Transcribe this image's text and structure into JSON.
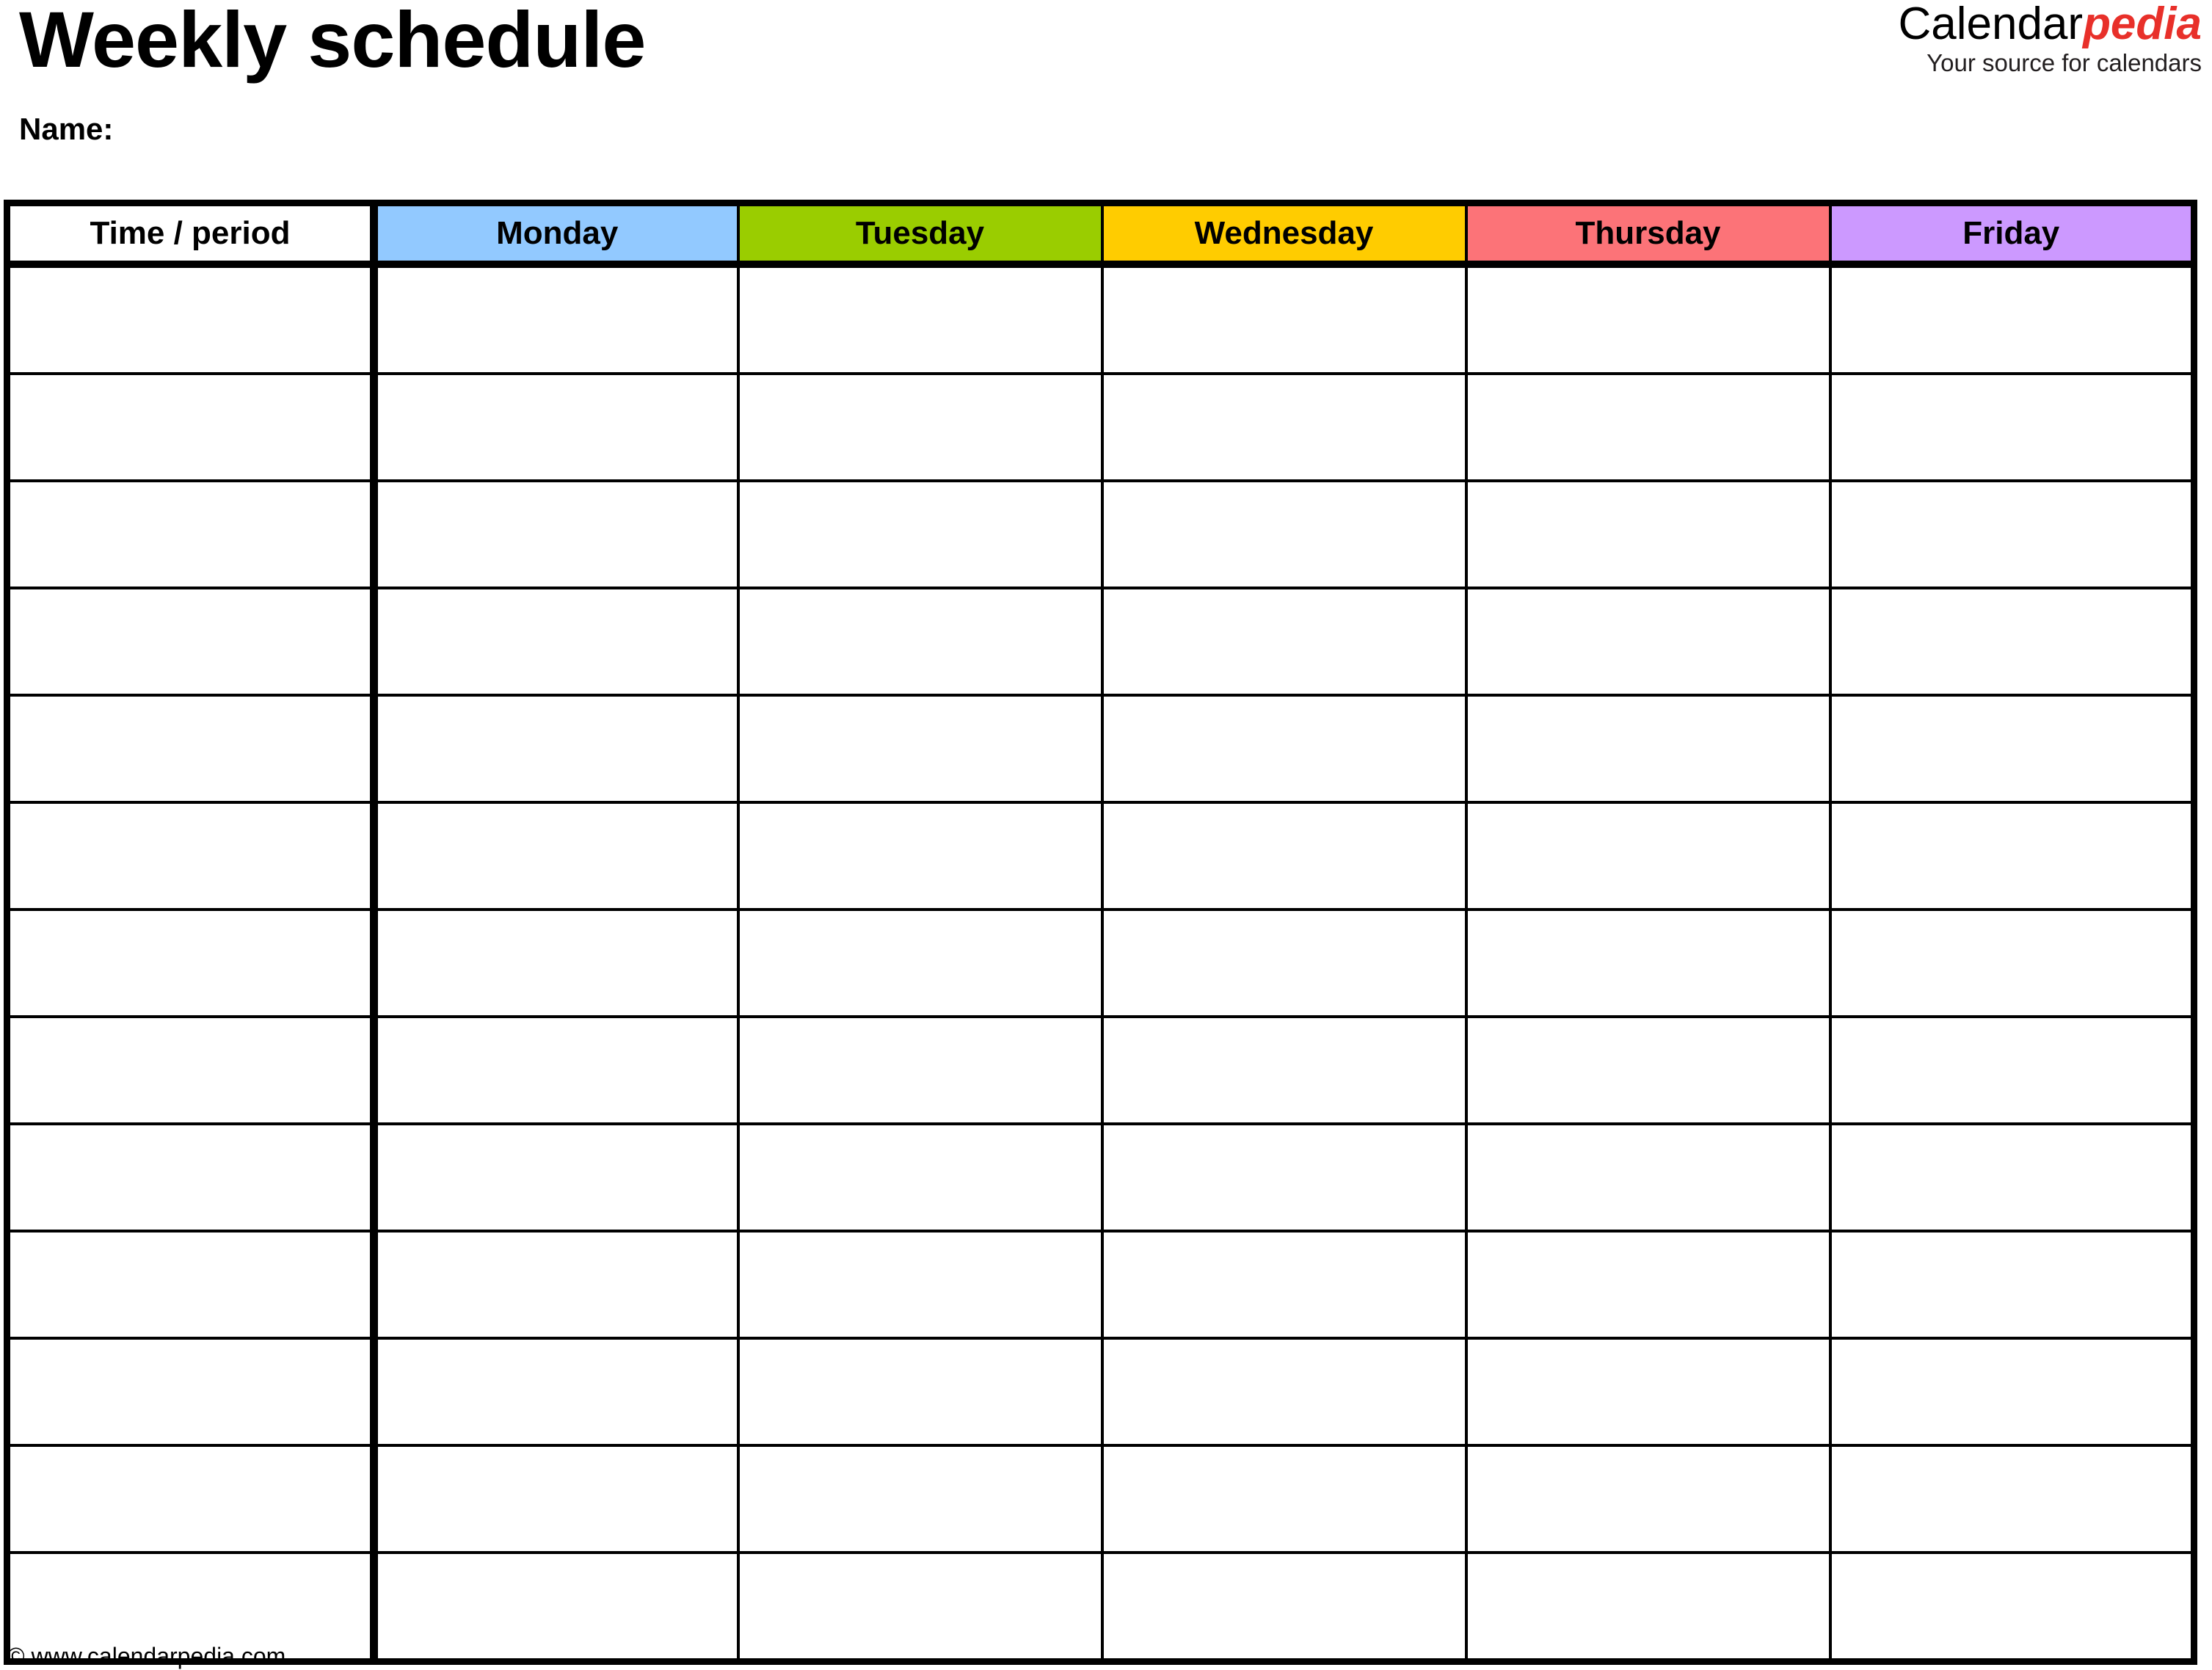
{
  "document": {
    "title": "Weekly schedule",
    "name_label": "Name:"
  },
  "brand": {
    "word_primary": "Calendar",
    "word_accent": "pedia",
    "tagline": "Your source for calendars",
    "accent_color": "#e8302a"
  },
  "table": {
    "columns": [
      {
        "label": "Time / period",
        "bg": "#ffffff",
        "kind": "time"
      },
      {
        "label": "Monday",
        "bg": "#92c9ff",
        "kind": "day"
      },
      {
        "label": "Tuesday",
        "bg": "#9acd00",
        "kind": "day"
      },
      {
        "label": "Wednesday",
        "bg": "#ffcc00",
        "kind": "day"
      },
      {
        "label": "Thursday",
        "bg": "#fc7378",
        "kind": "day"
      },
      {
        "label": "Friday",
        "bg": "#cc99ff",
        "kind": "day"
      }
    ],
    "row_count": 13,
    "rows": [
      [
        "",
        "",
        "",
        "",
        "",
        ""
      ],
      [
        "",
        "",
        "",
        "",
        "",
        ""
      ],
      [
        "",
        "",
        "",
        "",
        "",
        ""
      ],
      [
        "",
        "",
        "",
        "",
        "",
        ""
      ],
      [
        "",
        "",
        "",
        "",
        "",
        ""
      ],
      [
        "",
        "",
        "",
        "",
        "",
        ""
      ],
      [
        "",
        "",
        "",
        "",
        "",
        ""
      ],
      [
        "",
        "",
        "",
        "",
        "",
        ""
      ],
      [
        "",
        "",
        "",
        "",
        "",
        ""
      ],
      [
        "",
        "",
        "",
        "",
        "",
        ""
      ],
      [
        "",
        "",
        "",
        "",
        "",
        ""
      ],
      [
        "",
        "",
        "",
        "",
        "",
        ""
      ],
      [
        "",
        "",
        "",
        "",
        "",
        ""
      ]
    ]
  },
  "footer": {
    "copyright": "© www.calendarpedia.com"
  }
}
